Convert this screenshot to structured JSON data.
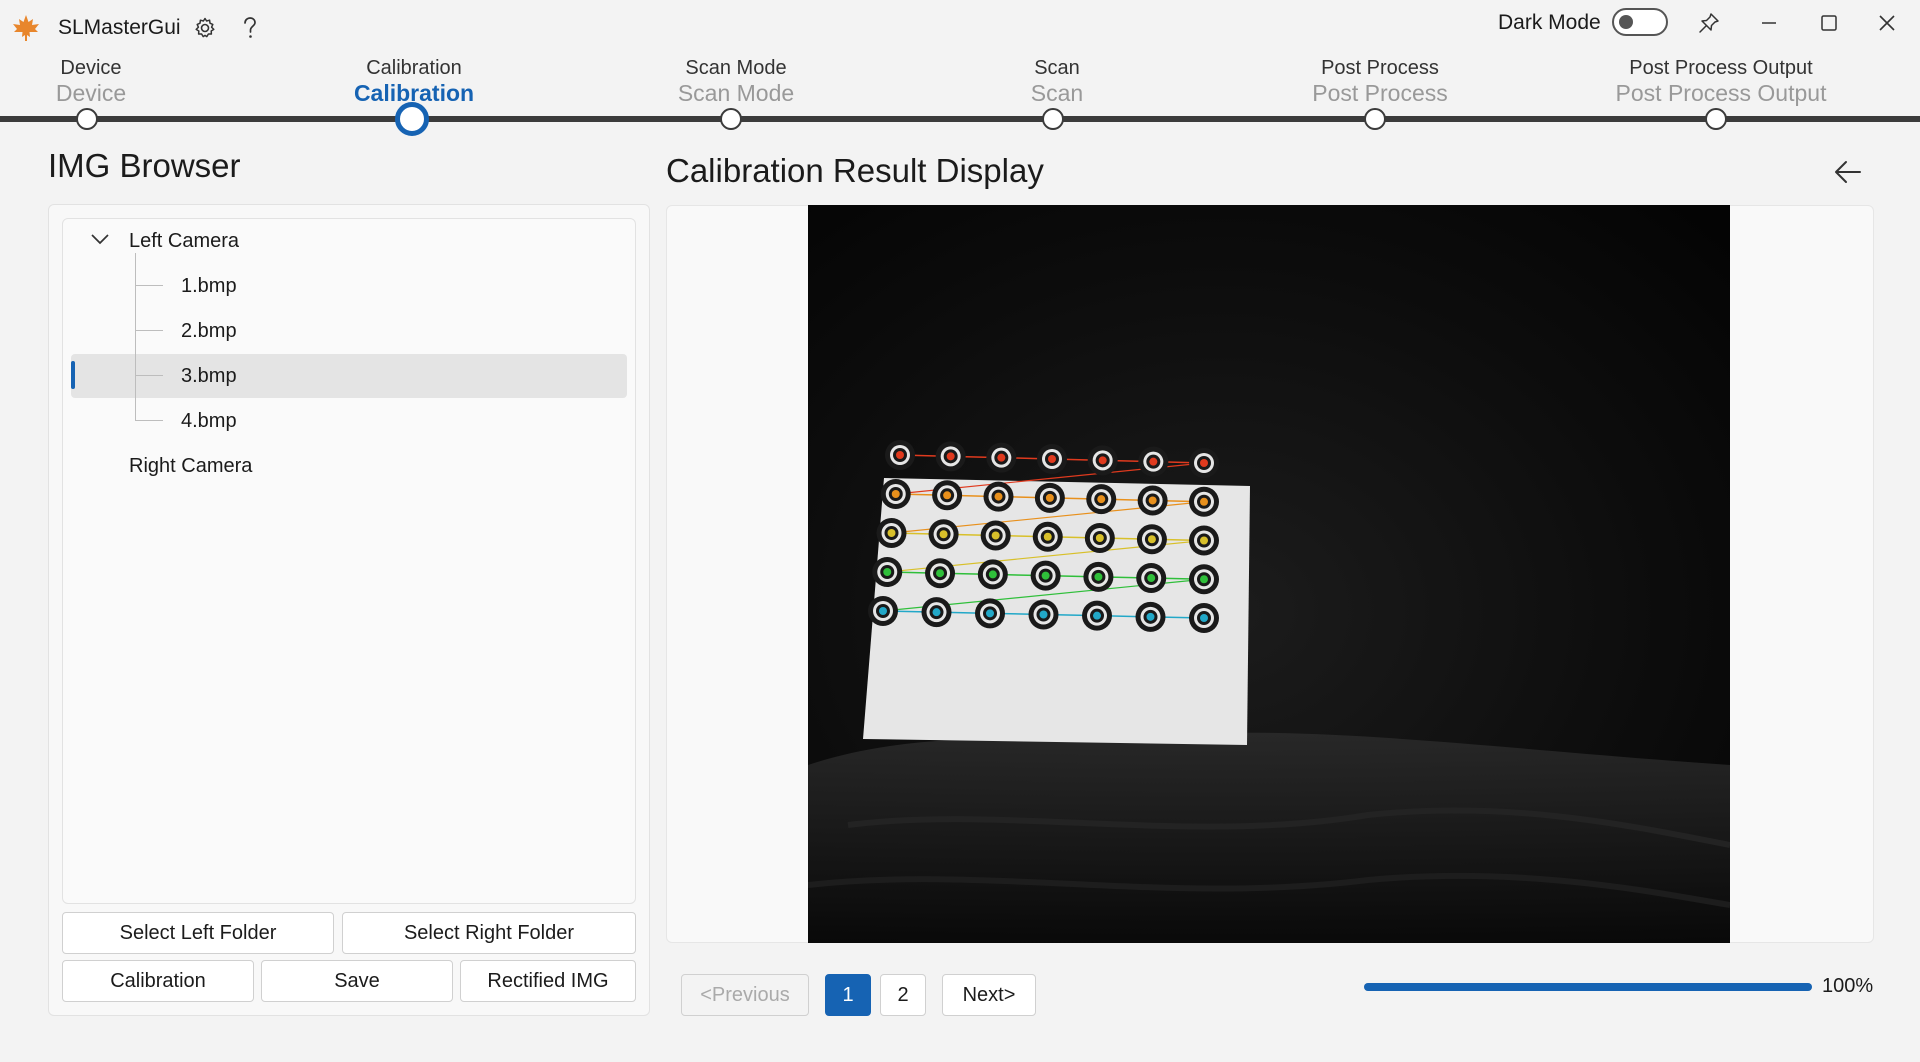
{
  "app": {
    "title": "SLMasterGui",
    "dark_mode_label": "Dark Mode",
    "dark_mode_on": false
  },
  "stepper": {
    "steps": [
      {
        "title": "Device",
        "subtitle": "Device",
        "active": false
      },
      {
        "title": "Calibration",
        "subtitle": "Calibration",
        "active": true
      },
      {
        "title": "Scan Mode",
        "subtitle": "Scan Mode",
        "active": false
      },
      {
        "title": "Scan",
        "subtitle": "Scan",
        "active": false
      },
      {
        "title": "Post Process",
        "subtitle": "Post Process",
        "active": false
      },
      {
        "title": "Post Process Output",
        "subtitle": "Post Process Output",
        "active": false
      }
    ]
  },
  "browser": {
    "title": "IMG Browser",
    "tree": {
      "left_camera": "Left Camera",
      "files": [
        "1.bmp",
        "2.bmp",
        "3.bmp",
        "4.bmp"
      ],
      "selected": "3.bmp",
      "right_camera": "Right Camera"
    },
    "buttons": {
      "select_left": "Select Left Folder",
      "select_right": "Select Right Folder",
      "calibration": "Calibration",
      "save": "Save",
      "rectified": "Rectified IMG"
    }
  },
  "display": {
    "title": "Calibration Result Display",
    "pagination": {
      "previous": "<Previous",
      "pages": [
        "1",
        "2"
      ],
      "current": "1",
      "next": "Next>"
    },
    "progress": {
      "percent": 100,
      "label": "100%"
    }
  },
  "icons": {
    "logo": "maple-leaf-icon",
    "settings": "gear-icon",
    "help": "question-icon",
    "pin": "pin-icon",
    "back": "arrow-left-icon"
  },
  "colors": {
    "accent": "#1663b3"
  }
}
